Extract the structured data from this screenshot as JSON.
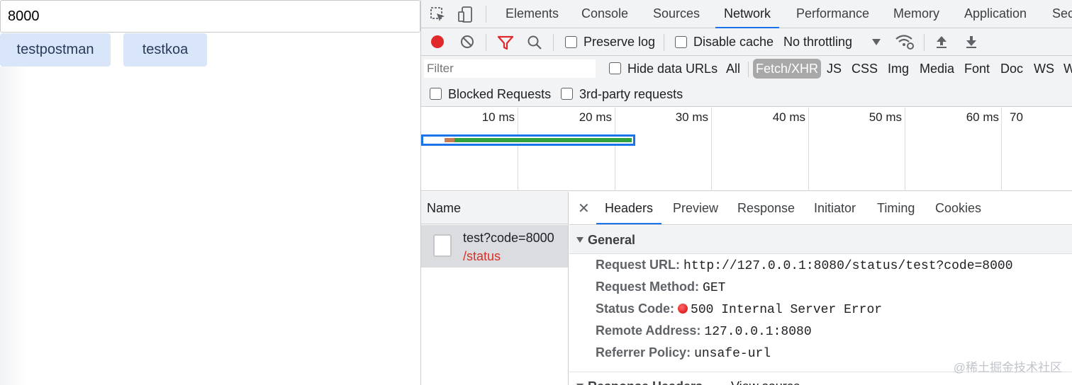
{
  "app": {
    "input_value": "8000",
    "buttons": [
      "testpostman",
      "testkoa"
    ]
  },
  "devtools": {
    "tabs": [
      "Elements",
      "Console",
      "Sources",
      "Network",
      "Performance",
      "Memory",
      "Application",
      "Sec"
    ],
    "active_tab": "Network",
    "toolbar": {
      "preserve_log": "Preserve log",
      "disable_cache": "Disable cache",
      "throttling": "No throttling"
    },
    "filter": {
      "placeholder": "Filter",
      "hide_data_urls": "Hide data URLs",
      "types": [
        "All",
        "Fetch/XHR",
        "JS",
        "CSS",
        "Img",
        "Media",
        "Font",
        "Doc",
        "WS",
        "W"
      ],
      "active_type": "Fetch/XHR",
      "blocked_requests": "Blocked Requests",
      "third_party": "3rd-party requests"
    },
    "overview": {
      "ticks": [
        "10 ms",
        "20 ms",
        "30 ms",
        "40 ms",
        "50 ms",
        "60 ms",
        "70"
      ]
    },
    "requests": {
      "column_name": "Name",
      "rows": [
        {
          "name": "test?code=8000",
          "path": "/status"
        }
      ]
    },
    "details": {
      "tabs": [
        "Headers",
        "Preview",
        "Response",
        "Initiator",
        "Timing",
        "Cookies"
      ],
      "active_tab": "Headers",
      "general": {
        "title": "General",
        "fields": [
          {
            "key": "Request URL:",
            "value": "http://127.0.0.1:8080/status/test?code=8000"
          },
          {
            "key": "Request Method:",
            "value": "GET"
          },
          {
            "key": "Status Code:",
            "value": "500 Internal Server Error"
          },
          {
            "key": "Remote Address:",
            "value": "127.0.0.1:8080"
          },
          {
            "key": "Referrer Policy:",
            "value": "unsafe-url"
          }
        ]
      },
      "response_headers": {
        "title": "Response Headers",
        "view_source": "View source"
      }
    }
  },
  "watermark": "@稀土掘金技术社区",
  "colors": {
    "record": "#e0292b",
    "accent": "#1a73e8",
    "error": "#d93025",
    "app_button": "#d9e6f9"
  }
}
